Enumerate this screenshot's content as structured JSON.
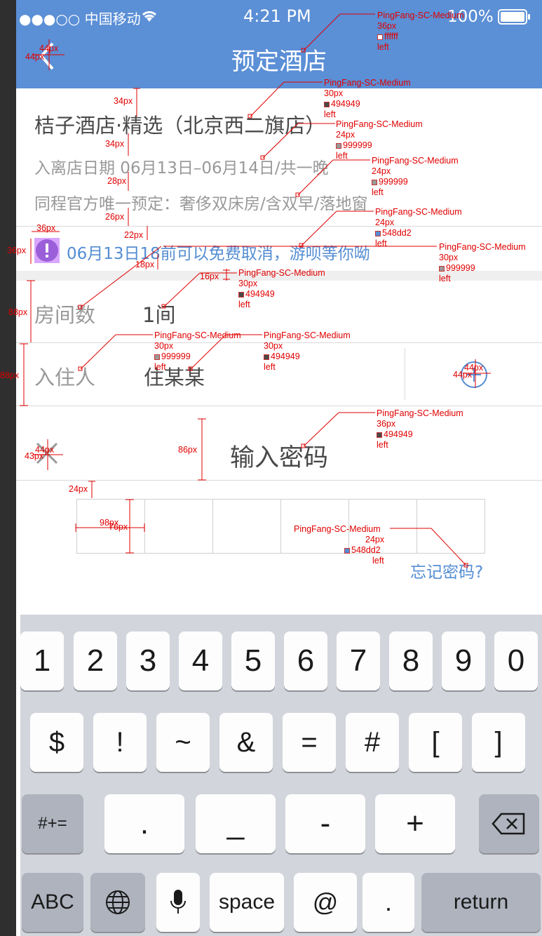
{
  "status_bar": {
    "carrier": "●●●○○ 中国移动",
    "time": "4:21 PM",
    "battery": "100%"
  },
  "nav": {
    "title": "预定酒店",
    "back_icon": "chevron-left-icon"
  },
  "hotel": {
    "name": "桔子酒店·精选（北京西二旗店）",
    "dates": "入离店日期 06月13日–06月14日/共一晚",
    "room_desc": "同程官方唯一预定：奢侈双床房/含双早/落地窗"
  },
  "notice": {
    "text": "06月13日18前可以免费取消，游呗等你呦",
    "icon": "exclamation-circle-icon"
  },
  "form": {
    "rooms_label": "房间数",
    "rooms_value": "1间",
    "guest_label": "入住人",
    "guest_value": "住某某",
    "add_icon": "plus-circle-icon"
  },
  "password": {
    "close_icon": "close-icon",
    "title": "输入密码",
    "cells": 6,
    "forgot": "忘记密码?"
  },
  "keyboard": {
    "row1": [
      "1",
      "2",
      "3",
      "4",
      "5",
      "6",
      "7",
      "8",
      "9",
      "0"
    ],
    "row2": [
      "$",
      "!",
      "~",
      "&",
      "=",
      "#",
      "[",
      "]"
    ],
    "row3_left": "#+=",
    "row3": [
      ".",
      "_",
      "-",
      "+"
    ],
    "row3_right_icon": "backspace-icon",
    "row4": {
      "abc": "ABC",
      "globe_icon": "globe-icon",
      "mic_icon": "microphone-icon",
      "space": "space",
      "at": "@",
      "dot": ".",
      "return": "return"
    }
  },
  "annotations": {
    "specs": [
      {
        "font": "PingFang-SC-Medium",
        "size": "36px",
        "color": "ffffff",
        "align": "left",
        "hex": "#ffffff"
      },
      {
        "font": "PingFang-SC-Medium",
        "size": "30px",
        "color": "494949",
        "align": "left",
        "hex": "#494949"
      },
      {
        "font": "PingFang-SC-Medium",
        "size": "24px",
        "color": "999999",
        "align": "left",
        "hex": "#999999"
      },
      {
        "font": "PingFang-SC-Medium",
        "size": "24px",
        "color": "999999",
        "align": "left",
        "hex": "#999999"
      },
      {
        "font": "PingFang-SC-Medium",
        "size": "24px",
        "color": "548dd2",
        "align": "left",
        "hex": "#548dd2"
      },
      {
        "font": "PingFang-SC-Medium",
        "size": "30px",
        "color": "999999",
        "align": "left",
        "hex": "#999999"
      },
      {
        "font": "PingFang-SC-Medium",
        "size": "30px",
        "color": "494949",
        "align": "left",
        "hex": "#494949"
      },
      {
        "font": "PingFang-SC-Medium",
        "size": "30px",
        "color": "999999",
        "align": "left",
        "hex": "#999999"
      },
      {
        "font": "PingFang-SC-Medium",
        "size": "30px",
        "color": "494949",
        "align": "left",
        "hex": "#494949"
      },
      {
        "font": "PingFang-SC-Medium",
        "size": "36px",
        "color": "494949",
        "align": "left",
        "hex": "#494949"
      },
      {
        "font": "PingFang-SC-Medium",
        "size": "24px",
        "color": "548dd2",
        "align": "left",
        "hex": "#548dd2"
      }
    ],
    "dims": [
      "44px",
      "44px",
      "34px",
      "34px",
      "28px",
      "26px",
      "36px",
      "36px",
      "22px",
      "18px",
      "16px",
      "88px",
      "88px",
      "44px",
      "44px",
      "44px",
      "43px",
      "86px",
      "24px",
      "98px",
      "76px"
    ]
  }
}
